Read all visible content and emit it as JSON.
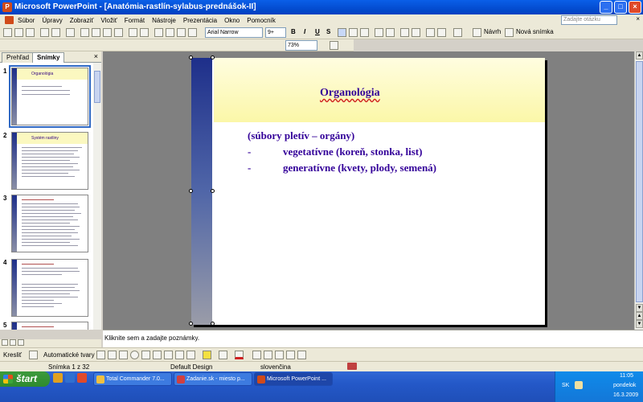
{
  "window": {
    "title": "Microsoft PowerPoint - [Anatómia-rastlín-sylabus-prednášok-II]",
    "minimize": "_",
    "maximize": "□",
    "close": "×"
  },
  "menubar": {
    "items": [
      "Súbor",
      "Úpravy",
      "Zobraziť",
      "Vložiť",
      "Formát",
      "Nástroje",
      "Prezentácia",
      "Okno",
      "Pomocník"
    ],
    "help_placeholder": "Zadajte otázku",
    "doc_close": "×"
  },
  "toolbar": {
    "font": "Arial Narrow",
    "font_size": "9+",
    "bold": "B",
    "italic": "I",
    "underline": "U",
    "shadow": "S",
    "design_label": "Návrh",
    "new_slide_label": "Nová snímka",
    "zoom": "73%"
  },
  "tabs": {
    "outline": "Prehľad",
    "slides": "Snímky",
    "close": "×"
  },
  "thumbnails": [
    {
      "num": "1",
      "title": "Organológia"
    },
    {
      "num": "2",
      "title": "Systém rastliny"
    },
    {
      "num": "3",
      "title": ""
    },
    {
      "num": "4",
      "title": ""
    },
    {
      "num": "5",
      "title": ""
    }
  ],
  "slide": {
    "title": "Organológia",
    "lines": [
      {
        "dash": "",
        "text": "(súbory pletív – orgány)"
      },
      {
        "dash": "-",
        "text": "vegetatívne (koreň, stonka, list)"
      },
      {
        "dash": "-",
        "text": "generatívne (kvety, plody, semená)"
      }
    ]
  },
  "notes": {
    "placeholder": "Kliknite sem a zadajte poznámky."
  },
  "drawbar": {
    "draw_label": "Kresliť",
    "autoshapes_label": "Automatické tvary"
  },
  "status": {
    "slide": "Snímka 1 z 32",
    "design": "Default Design",
    "language": "slovenčina"
  },
  "taskbar": {
    "start": "štart",
    "buttons": [
      {
        "label": "Total Commander 7.0..."
      },
      {
        "label": "Zadanie.sk - miesto p..."
      },
      {
        "label": "Microsoft PowerPoint ..."
      }
    ],
    "lang": "SK",
    "time": "11:05",
    "day": "pondelok",
    "date": "16.3.2009"
  },
  "colors": {
    "title_text": "#330099",
    "accent_bar": "#1e2f8a",
    "header_band": "#fbf7a8"
  }
}
